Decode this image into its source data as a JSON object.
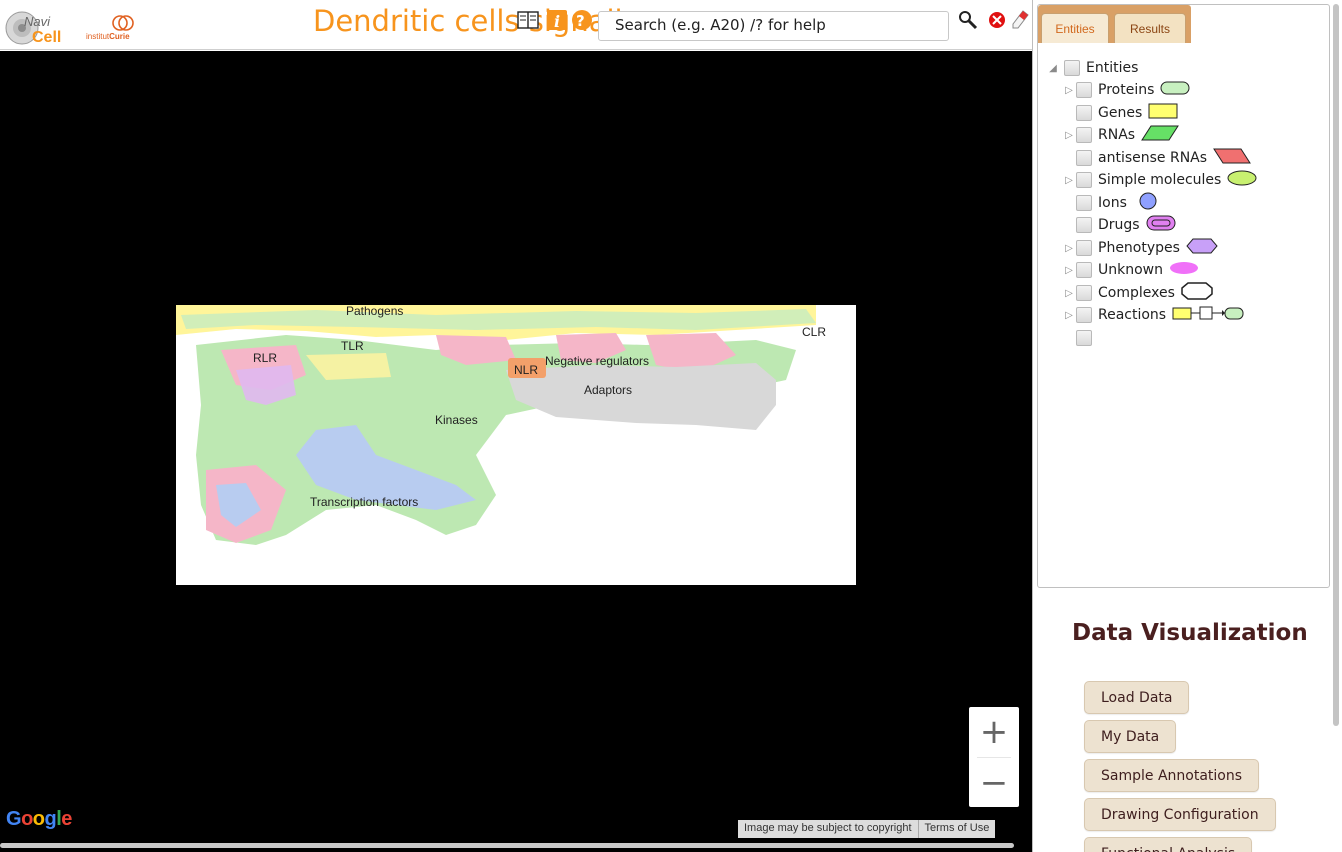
{
  "header": {
    "title": "Dendritic cells signaling",
    "logo_navicell_text": "Navi Cell",
    "logo_curie_text": "institutCurie",
    "search_placeholder": "Search (e.g. A20)  /? for help"
  },
  "map": {
    "labels": {
      "pathogens": "Pathogens",
      "rlr": "RLR",
      "tlr": "TLR",
      "nlr": "NLR",
      "negative_regulators": "Negative regulators",
      "adaptors": "Adaptors",
      "kinases": "Kinases",
      "transcription_factors": "Transcription factors",
      "clr": "CLR"
    },
    "zoom_in": "+",
    "zoom_out": "−",
    "google": [
      "G",
      "o",
      "o",
      "g",
      "l",
      "e"
    ],
    "attribution": {
      "copyright": "Image may be subject to copyright",
      "terms": "Terms of Use"
    }
  },
  "tabs": {
    "entities": "Entities",
    "results": "Results"
  },
  "tree": {
    "root": "Entities",
    "items": [
      {
        "label": "Proteins",
        "shape": "rounded-rect",
        "color": "#c8f0c0"
      },
      {
        "label": "Genes",
        "shape": "rect",
        "color": "#ffff70"
      },
      {
        "label": "RNAs",
        "shape": "parallelogram",
        "color": "#66e066"
      },
      {
        "label": "antisense RNAs",
        "shape": "parallelogram-reverse",
        "color": "#f07070"
      },
      {
        "label": "Simple molecules",
        "shape": "ellipse",
        "color": "#c8f070"
      },
      {
        "label": "Ions",
        "shape": "circle",
        "color": "#8fa0ff"
      },
      {
        "label": "Drugs",
        "shape": "drug",
        "color": "#e080f0"
      },
      {
        "label": "Phenotypes",
        "shape": "hexagon",
        "color": "#c8a0f8"
      },
      {
        "label": "Unknown",
        "shape": "ellipse",
        "color": "#f070f8"
      },
      {
        "label": "Complexes",
        "shape": "octagon",
        "color": "#ffffff"
      },
      {
        "label": "Reactions",
        "shape": "reaction",
        "color": "#ffff70"
      }
    ]
  },
  "data_visualization": {
    "title": "Data Visualization",
    "buttons": [
      "Load Data",
      "My Data",
      "Sample Annotations",
      "Drawing Configuration",
      "Functional Analysis"
    ]
  }
}
